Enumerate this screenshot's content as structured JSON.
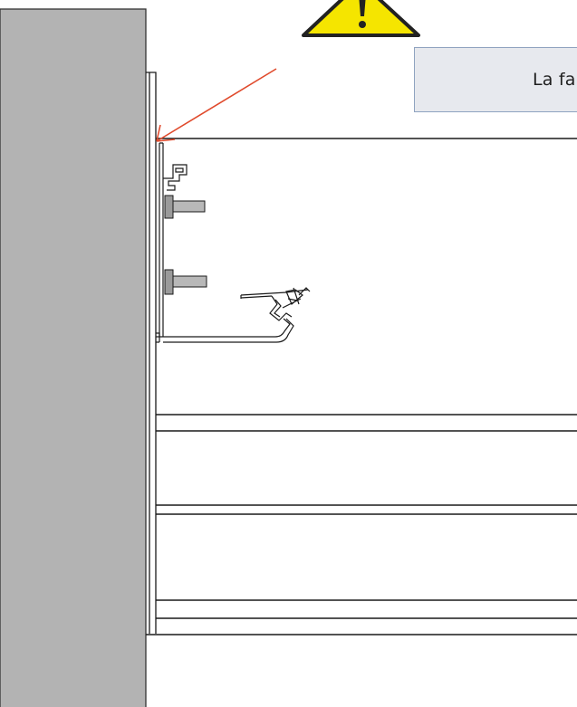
{
  "callout": {
    "text": "La fa"
  },
  "warning": {
    "icon": "warning-triangle-icon",
    "symbol": "!"
  },
  "colors": {
    "wall": "#b3b3b3",
    "arrow": "#e04a2c",
    "warning_fill": "#f5e500",
    "callout_bg": "#e7e9ee",
    "callout_border": "#8fa3c0",
    "line": "#1a1a1a",
    "bracket_fill": "#c2c2c2"
  }
}
